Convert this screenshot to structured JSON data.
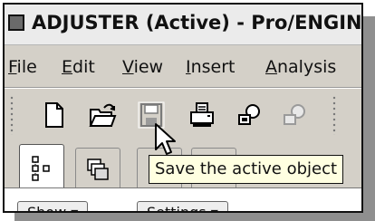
{
  "window": {
    "title": "ADJUSTER (Active) - Pro/ENGIN"
  },
  "menu": {
    "items": [
      {
        "key": "F",
        "rest": "ile"
      },
      {
        "key": "E",
        "rest": "dit"
      },
      {
        "key": "V",
        "rest": "iew"
      },
      {
        "key": "I",
        "rest": "nsert"
      },
      {
        "key": "A",
        "rest": "nalysis"
      }
    ]
  },
  "toolbar": {
    "icons": [
      "new-file-icon",
      "open-folder-icon",
      "save-icon",
      "print-icon",
      "send-mail-icon",
      "send-mail-disabled-icon"
    ],
    "hovered": "save-icon"
  },
  "tabs": {
    "icons": [
      "model-tree-icon",
      "folder-browser-icon",
      "favorites-icon",
      "connections-icon"
    ],
    "active": "model-tree-icon"
  },
  "tooltip": {
    "text": "Save the active object"
  },
  "bottom_bar": {
    "show_label": "Show ▾",
    "settings_label": "Settings ▾"
  },
  "colors": {
    "window_bg": "#d4d0c8",
    "tooltip_bg": "#ffffe1",
    "title_bg": "#ebebeb"
  }
}
